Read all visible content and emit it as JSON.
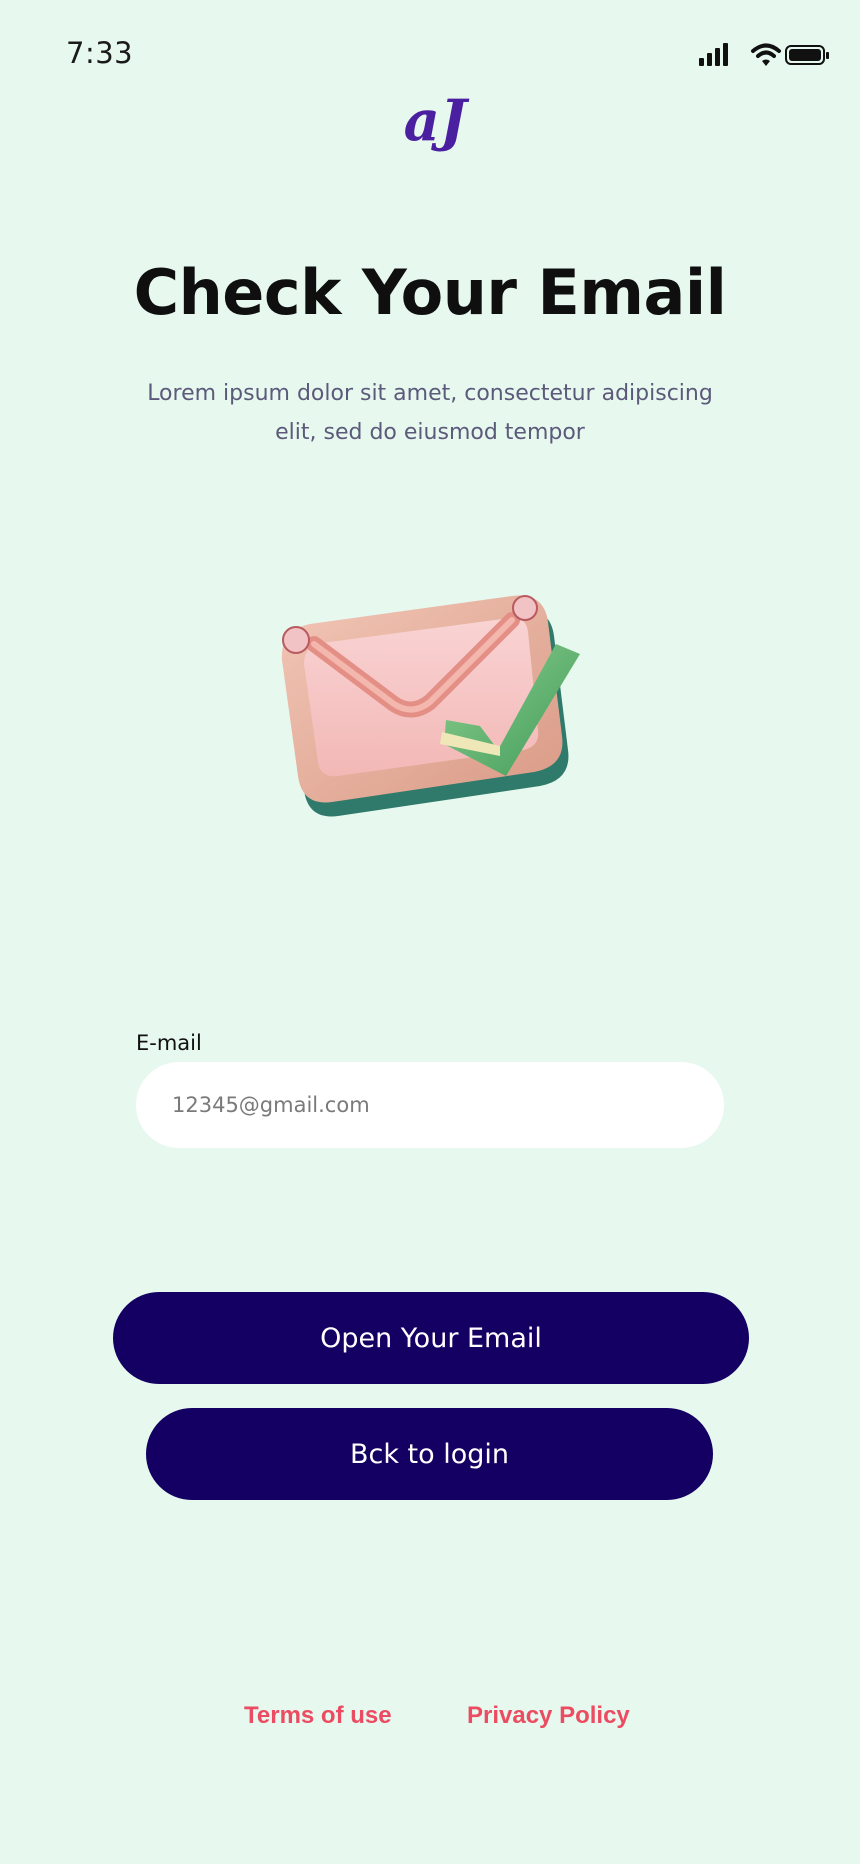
{
  "status_bar": {
    "time": "7:33",
    "icons": [
      "signal-icon",
      "wifi-icon",
      "battery-icon"
    ]
  },
  "logo": {
    "text": "aJ",
    "color": "#4a1fa0"
  },
  "header": {
    "title": "Check Your Email",
    "subtitle": "Lorem ipsum dolor sit amet, consectetur adipiscing elit, sed do eiusmod tempor"
  },
  "illustration": {
    "icon": "email-check-icon"
  },
  "form": {
    "email_label": "E-mail",
    "email_placeholder": "12345@gmail.com",
    "email_value": ""
  },
  "actions": {
    "open_email_label": "Open Your Email",
    "back_to_login_label": "Bck to login"
  },
  "footer": {
    "terms_label": "Terms of use",
    "privacy_label": "Privacy Policy"
  },
  "colors": {
    "background": "#e7f8ef",
    "button": "#130062",
    "link": "#ec4c62",
    "title": "#0f0f10",
    "subtitle": "#5c5a7a"
  }
}
